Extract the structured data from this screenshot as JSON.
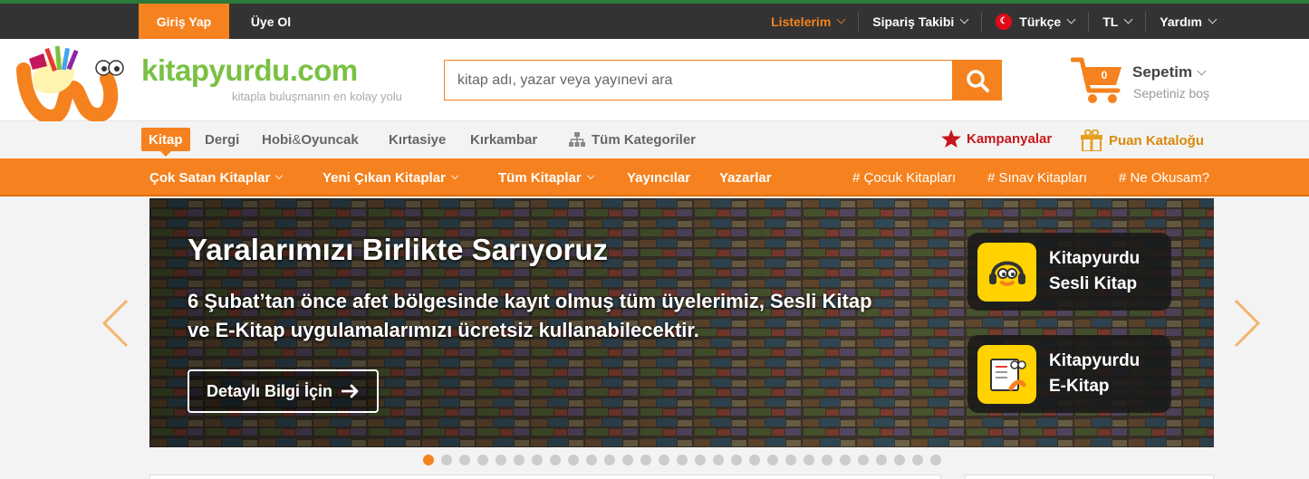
{
  "topbar": {
    "login": "Giriş Yap",
    "register": "Üye Ol",
    "links": [
      "Listelerim",
      "Sipariş Takibi",
      "Türkçe",
      "TL",
      "Yardım"
    ]
  },
  "header": {
    "logo": "kitapyurdu.com",
    "slogan": "kitapla buluşmanın en kolay yolu",
    "search_placeholder": "kitap adı, yazar veya yayınevi ara",
    "cart_count": "0",
    "cart_title": "Sepetim",
    "cart_sub": "Sepetiniz boş"
  },
  "categories": {
    "items": [
      "Kitap",
      "Dergi",
      "Hobi",
      "&",
      "Oyuncak",
      "Kırtasiye",
      "Kırkambar",
      "Tüm Kategoriler"
    ],
    "campaigns": "Kampanyalar",
    "points": "Puan Kataloğu"
  },
  "nav": {
    "items": [
      "Çok Satan Kitaplar",
      "Yeni Çıkan Kitaplar",
      "Tüm Kitaplar",
      "Yayıncılar",
      "Yazarlar"
    ],
    "tags": [
      "# Çocuk Kitapları",
      "# Sınav Kitapları",
      "# Ne Okusam?"
    ]
  },
  "banner": {
    "title": "Yaralarımızı Birlikte Sarıyoruz",
    "text": "6 Şubat’tan önce afet bölgesinde kayıt olmuş tüm üyelerimiz, Sesli Kitap ve E-Kitap uygulamalarımızı ücretsiz kullanabilecektir.",
    "button": "Detaylı Bilgi İçin",
    "app1": "Kitapyurdu Sesli Kitap",
    "app2": "Kitapyurdu E-Kitap"
  },
  "colors": {
    "accent": "#f5821f",
    "logo_green": "#7ac143",
    "dark": "#333333"
  },
  "carousel": {
    "total": 29,
    "active": 1
  }
}
